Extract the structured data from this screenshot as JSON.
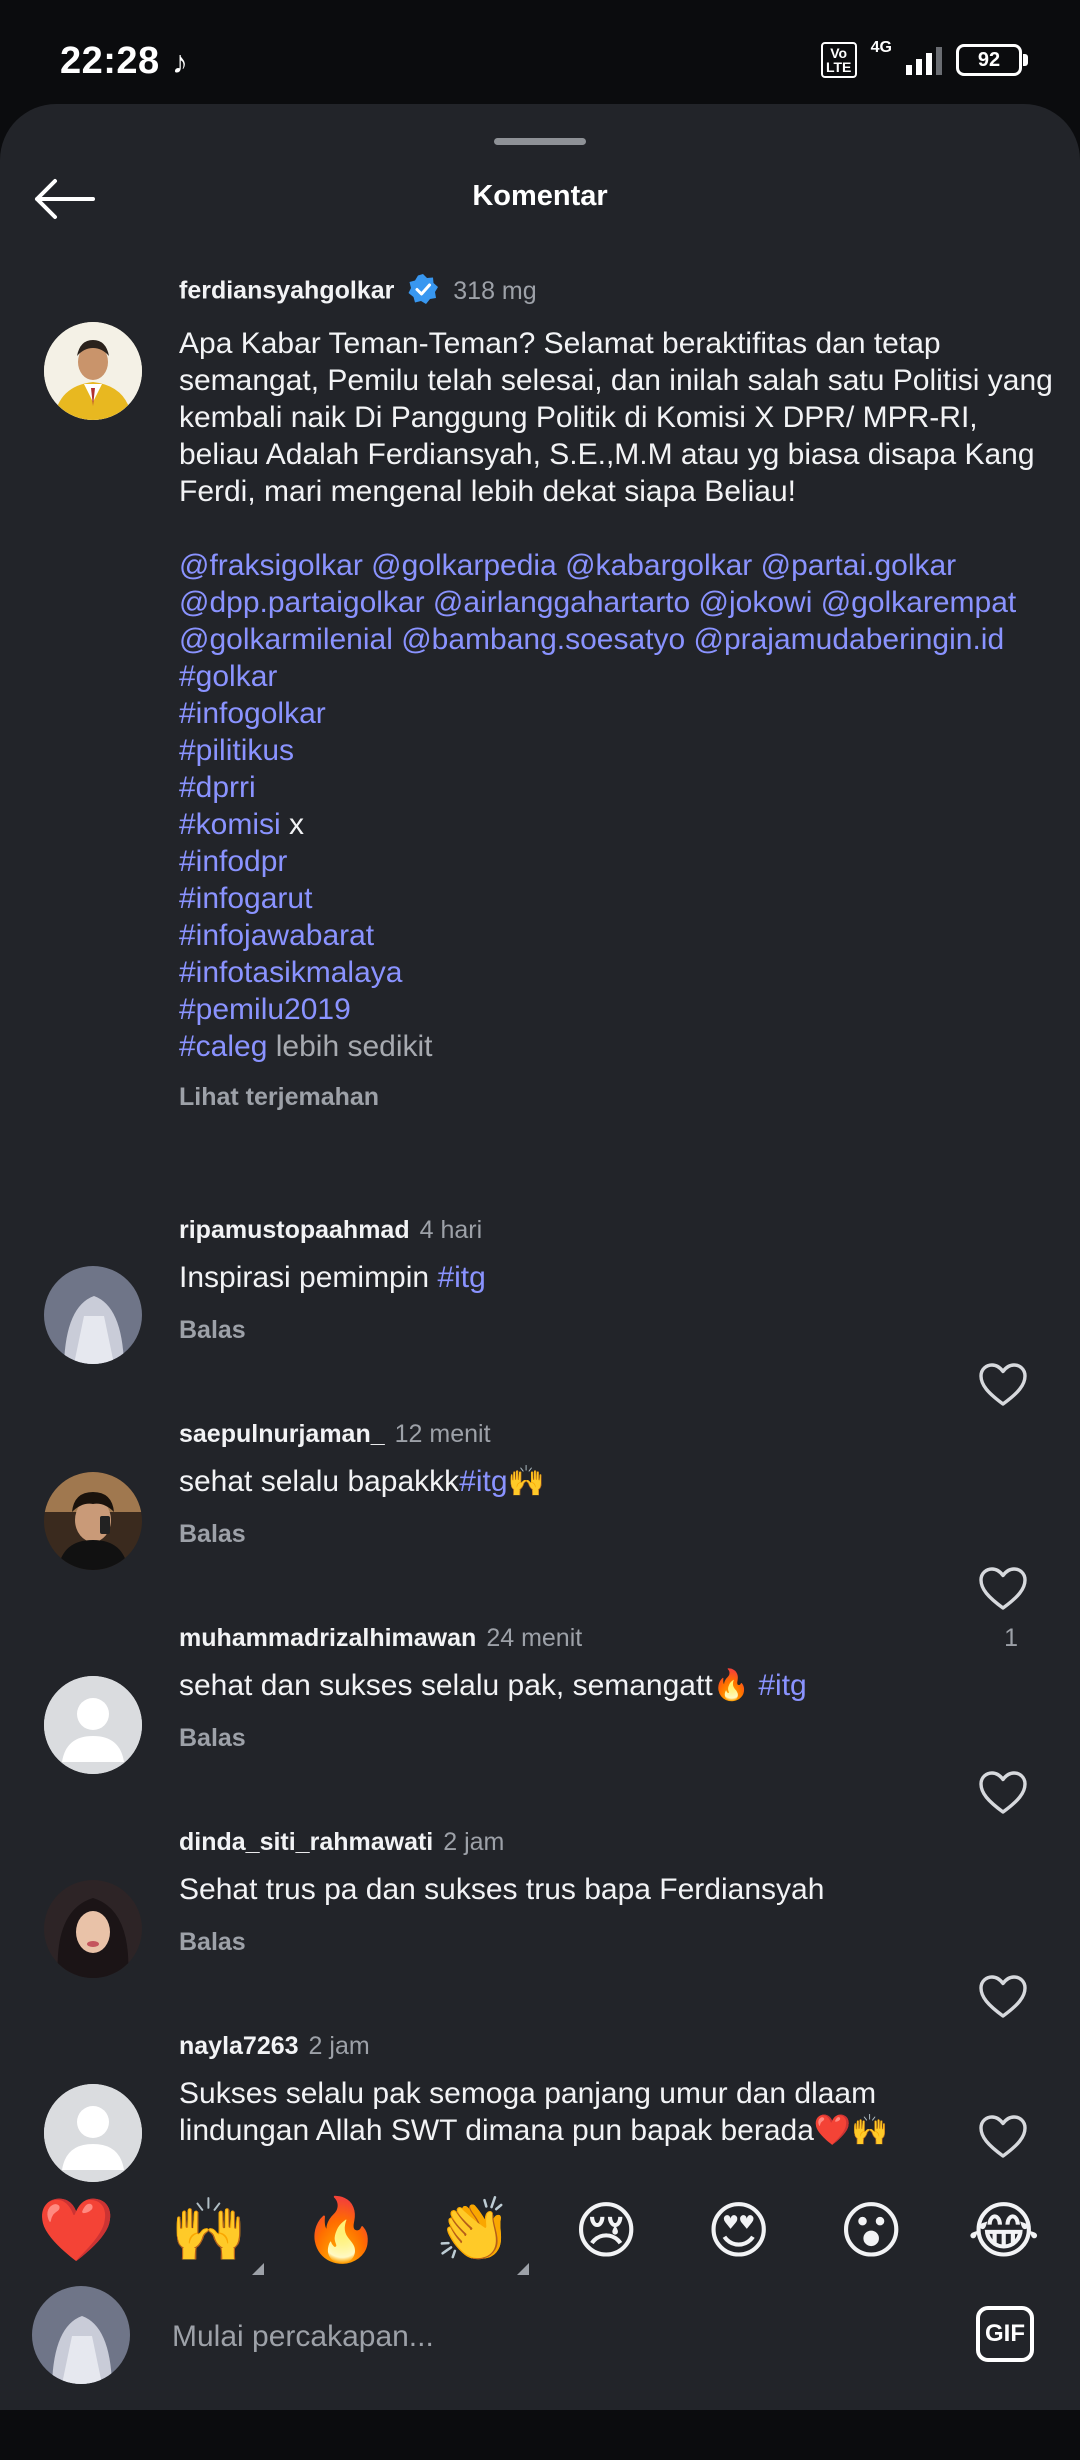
{
  "status_bar": {
    "time": "22:28",
    "tiktok_icon": "tiktok-icon",
    "volte": "Vo LTE",
    "network": "4G",
    "battery": "92"
  },
  "header": {
    "title": "Komentar"
  },
  "caption": {
    "username": "ferdiansyahgolkar",
    "time": "318 mg",
    "text": "Apa Kabar Teman-Teman? Selamat beraktifitas dan tetap semangat, Pemilu telah selesai, dan inilah salah satu Politisi yang kembali naik Di Panggung Politik di Komisi X DPR/ MPR-RI, beliau Adalah Ferdiansyah, S.E.,M.M atau yg biasa disapa Kang Ferdi, mari mengenal lebih dekat siapa Beliau!",
    "mention_lines": [
      "@fraksigolkar @golkarpedia @kabargolkar @partai.golkar",
      "@dpp.partaigolkar @airlanggahartarto @jokowi @golkarempat",
      "@golkarmilenial @bambang.soesatyo @prajamudaberingin.id"
    ],
    "hashtags": [
      "#golkar",
      "#infogolkar",
      "#pilitikus",
      "#dprri"
    ],
    "komisi_tag": "#komisi",
    "komisi_suffix": " x",
    "hashtags2": [
      "#infodpr",
      "#infogarut",
      "#infojawabarat",
      "#infotasikmalaya",
      "#pemilu2019"
    ],
    "last_tag": "#caleg",
    "more_label": " lebih sedikit",
    "translate_label": "Lihat terjemahan"
  },
  "comments": [
    {
      "username": "ripamustopaahmad",
      "time": "4 hari",
      "text": "Inspirasi pemimpin ",
      "tag": "#itg",
      "reply": "Balas",
      "likes": ""
    },
    {
      "username": "saepulnurjaman_",
      "time": "12 menit",
      "text": "sehat selalu bapakkk",
      "tag": "#itg",
      "emoji": "🙌",
      "reply": "Balas",
      "likes": "1"
    },
    {
      "username": "muhammadrizalhimawan",
      "time": "24 menit",
      "text": "sehat dan sukses selalu pak, semangatt🔥 ",
      "tag": "#itg",
      "reply": "Balas",
      "likes": ""
    },
    {
      "username": "dinda_siti_rahmawati",
      "time": "2 jam",
      "text": "Sehat trus pa dan sukses trus bapa Ferdiansyah",
      "reply": "Balas",
      "likes": ""
    },
    {
      "username": "nayla7263",
      "time": "2 jam",
      "text": "Sukses selalu pak semoga panjang umur dan dlaam lindungan Allah SWT dimana pun bapak berada❤️🙌",
      "reply": "Balas",
      "likes": ""
    }
  ],
  "reactions": [
    "❤️",
    "🙌",
    "🔥",
    "👏",
    "😢",
    "😍",
    "😮",
    "😂"
  ],
  "input": {
    "placeholder": "Mulai percakapan...",
    "gif_label": "GIF"
  },
  "colors": {
    "background": "#222429",
    "link": "#8a93ff",
    "muted": "#9da1a8",
    "verified": "#3897f0"
  }
}
